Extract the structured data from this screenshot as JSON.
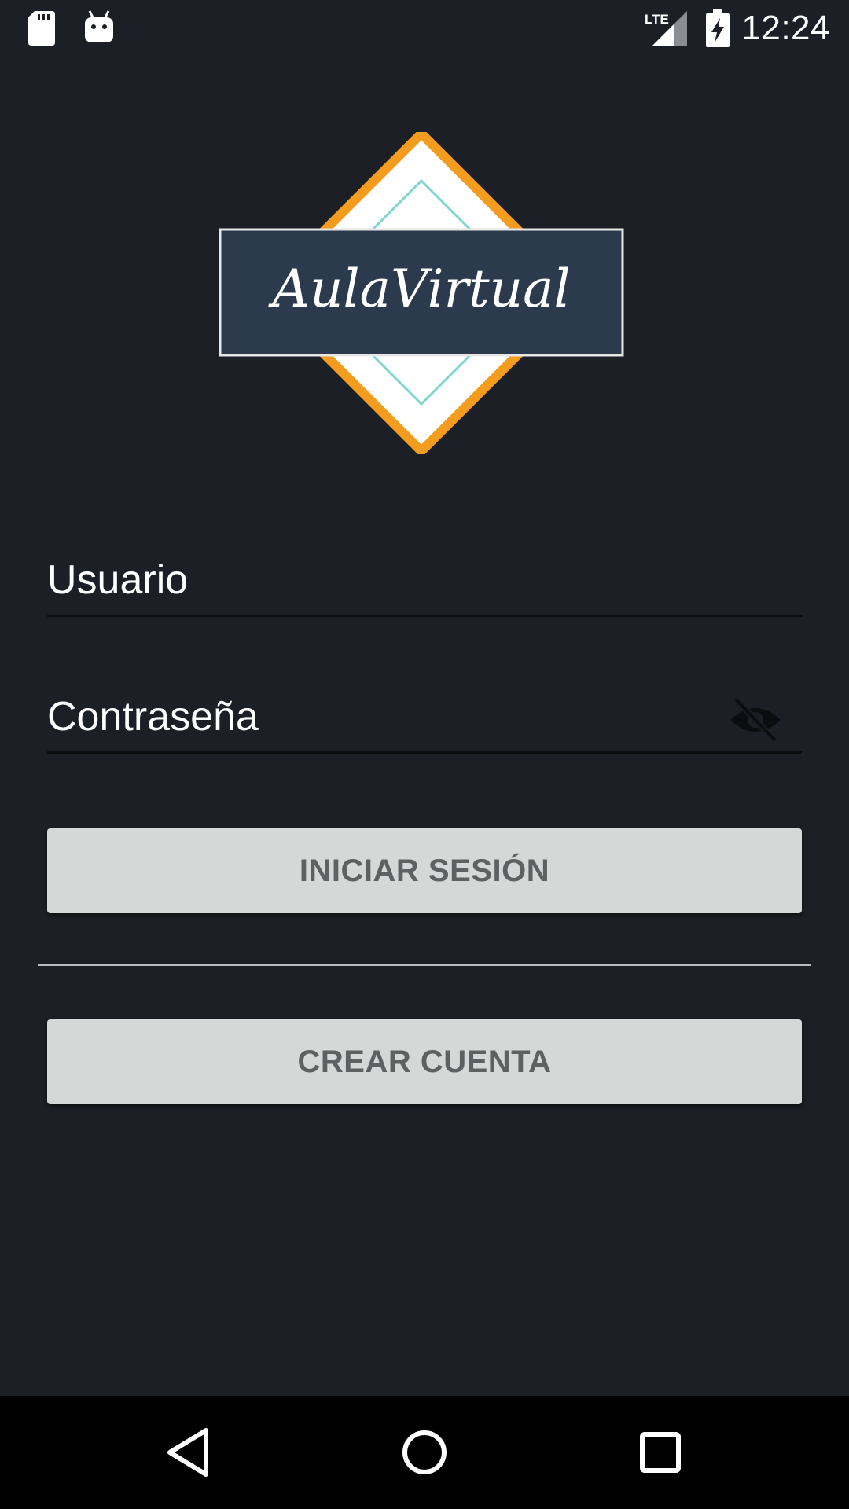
{
  "status_bar": {
    "time": "12:24",
    "network": "LTE",
    "icons": [
      "sd-card-icon",
      "android-debug-icon",
      "lte-signal-icon",
      "battery-charging-icon"
    ]
  },
  "logo": {
    "text": "AulaVirtual",
    "colors": {
      "diamond_border": "#f39c1e",
      "inner_line": "#7fd6cf",
      "banner": "#2c3a4e"
    }
  },
  "form": {
    "username": {
      "label": "Usuario"
    },
    "password": {
      "label": "Contraseña",
      "toggle_icon": "eye-off-icon"
    }
  },
  "buttons": {
    "login": "INICIAR SESIÓN",
    "create_account": "CREAR CUENTA"
  },
  "nav_bar": {
    "icons": [
      "back-icon",
      "home-icon",
      "recents-icon"
    ]
  },
  "colors": {
    "background": "#1c1f25",
    "button_bg": "#d6d7d7",
    "button_text": "#5f6061",
    "field_line": "#0b0d10"
  }
}
